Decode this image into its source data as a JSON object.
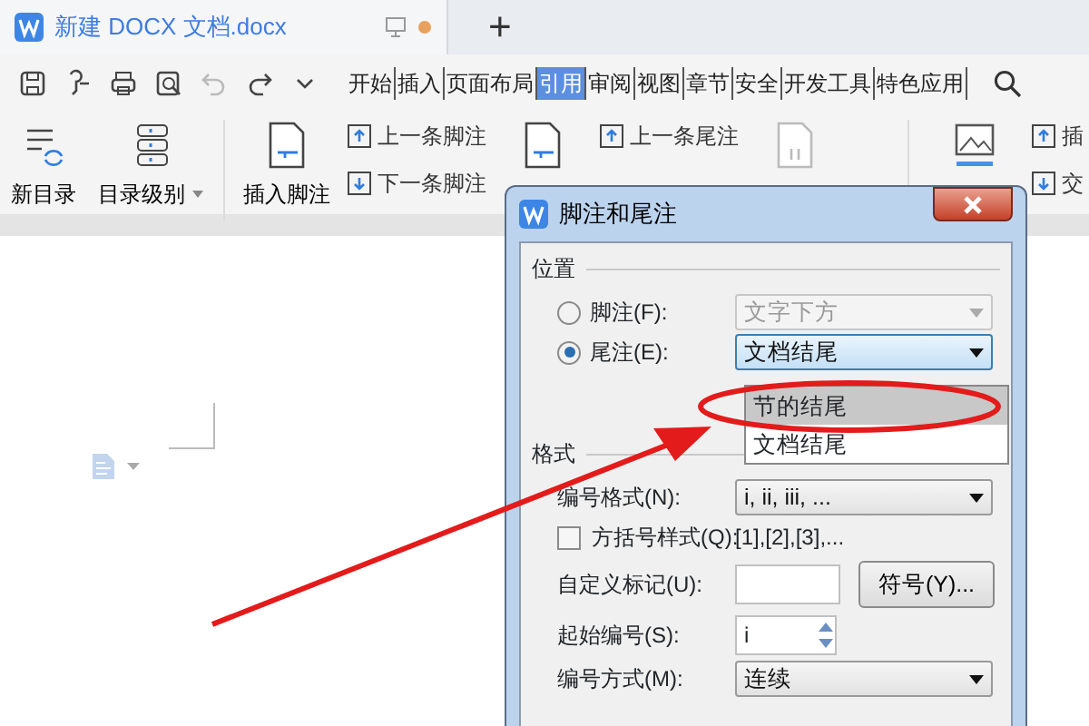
{
  "document_tab": {
    "title": "新建 DOCX 文档.docx",
    "modified": true,
    "new_tab": "+"
  },
  "menu_tabs": [
    {
      "label": "开始",
      "selected": false
    },
    {
      "label": "插入",
      "selected": false
    },
    {
      "label": "页面布局",
      "selected": false
    },
    {
      "label": "引用",
      "selected": true
    },
    {
      "label": "审阅",
      "selected": false
    },
    {
      "label": "视图",
      "selected": false
    },
    {
      "label": "章节",
      "selected": false
    },
    {
      "label": "安全",
      "selected": false
    },
    {
      "label": "开发工具",
      "selected": false
    },
    {
      "label": "特色应用",
      "selected": false
    }
  ],
  "ribbon": [
    {
      "kind": "large",
      "label": "新目录"
    },
    {
      "kind": "large",
      "label": "目录级别",
      "dropdown": true
    },
    {
      "kind": "divider"
    },
    {
      "kind": "large",
      "label": "插入脚注"
    },
    {
      "kind": "pair",
      "labels": [
        "上一条脚注",
        "下一条脚注"
      ]
    },
    {
      "kind": "large"
    },
    {
      "kind": "pair",
      "labels": [
        "上一条尾注"
      ]
    },
    {
      "kind": "large",
      "disabled": true
    },
    {
      "kind": "divider"
    },
    {
      "kind": "large"
    },
    {
      "kind": "pair",
      "labels": [
        "插",
        "交"
      ]
    }
  ],
  "dialog": {
    "title": "脚注和尾注",
    "position": {
      "heading": "位置",
      "options": [
        {
          "label": "脚注(F):",
          "selected": false,
          "value": "文字下方",
          "disabled": true
        },
        {
          "label": "尾注(E):",
          "selected": true,
          "value": "文档结尾",
          "disabled": false
        }
      ]
    },
    "dropdown_list": [
      {
        "label": "节的结尾",
        "selected": true
      },
      {
        "label": "文档结尾",
        "selected": false
      }
    ],
    "format": {
      "heading": "格式",
      "number_format": {
        "label": "编号格式(N):",
        "value": "i, ii, iii, ..."
      },
      "brackets": {
        "label": "方括号样式(Q):",
        "checked": false,
        "sample": "[1],[2],[3],..."
      },
      "custom_mark": {
        "label": "自定义标记(U):",
        "button": "符号(Y)..."
      },
      "start_at": {
        "label": "起始编号(S):",
        "value": "i"
      },
      "numbering": {
        "label": "编号方式(M):",
        "value": "连续"
      }
    }
  }
}
